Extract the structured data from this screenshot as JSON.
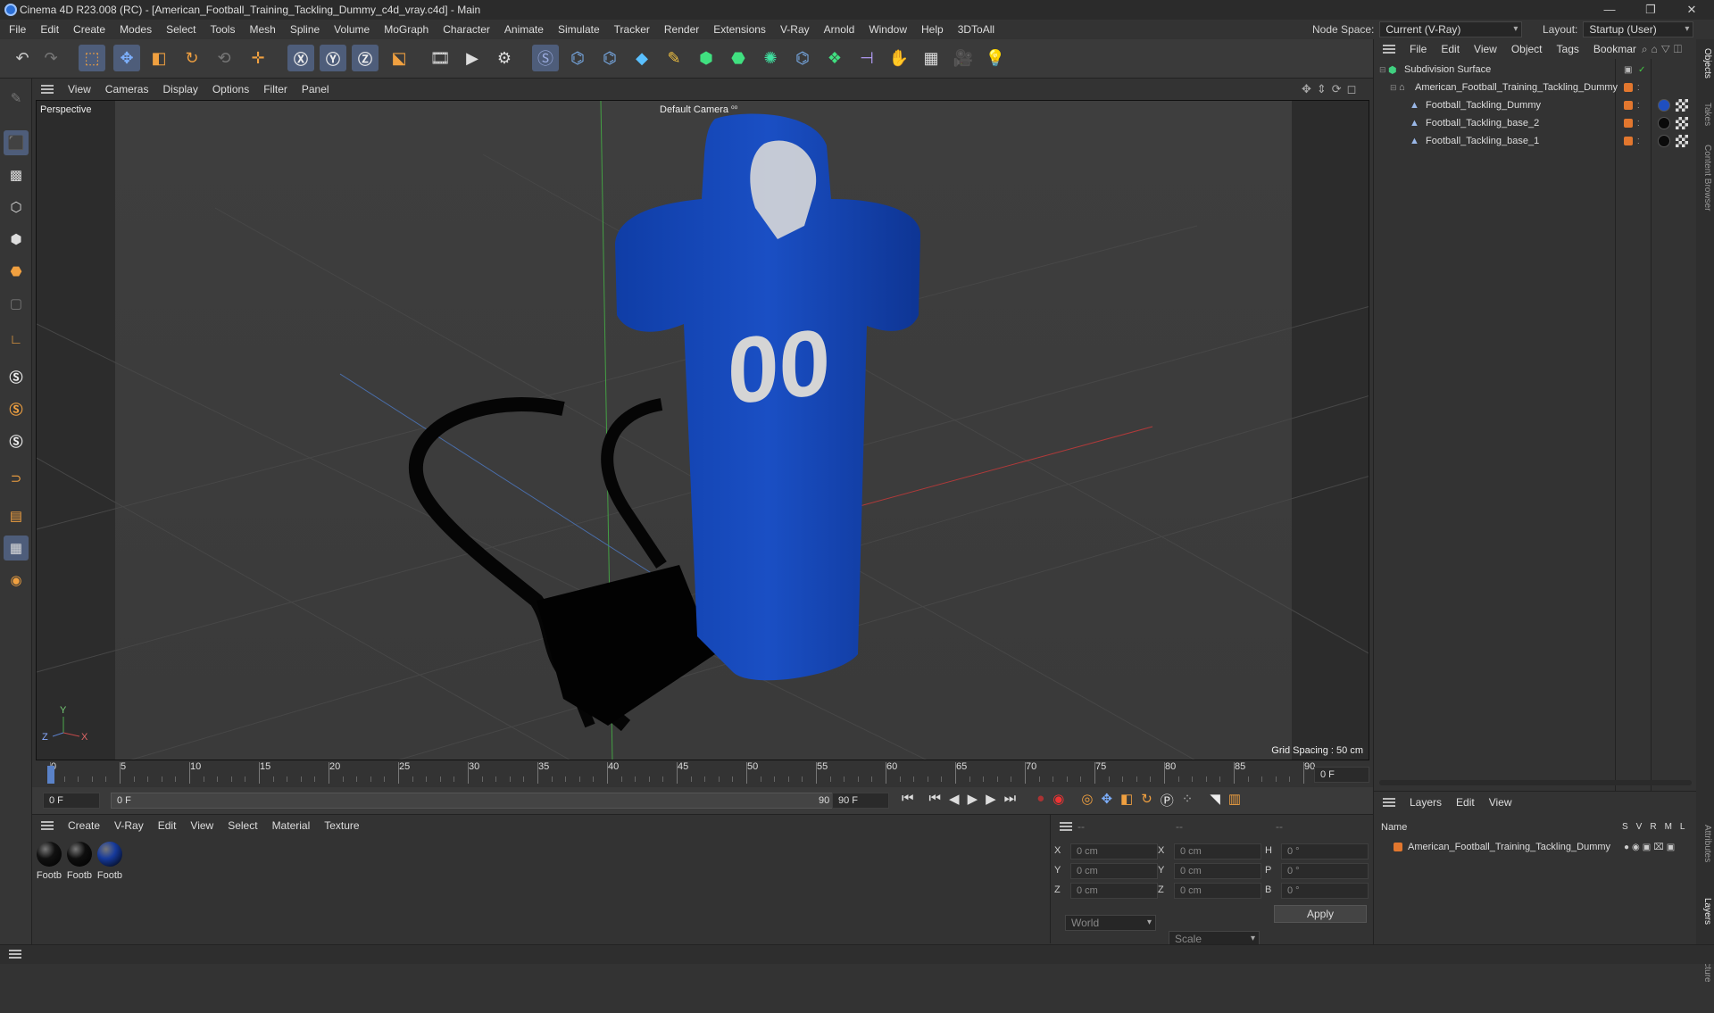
{
  "window": {
    "title": "Cinema 4D R23.008 (RC) - [American_Football_Training_Tackling_Dummy_c4d_vray.c4d] - Main",
    "minimize": "—",
    "restore": "❐",
    "close": "✕"
  },
  "menubar": {
    "items": [
      "File",
      "Edit",
      "Create",
      "Modes",
      "Select",
      "Tools",
      "Mesh",
      "Spline",
      "Volume",
      "MoGraph",
      "Character",
      "Animate",
      "Simulate",
      "Tracker",
      "Render",
      "Extensions",
      "V-Ray",
      "Arnold",
      "Window",
      "Help",
      "3DToAll"
    ],
    "node_space_label": "Node Space:",
    "node_space_value": "Current (V-Ray)",
    "layout_label": "Layout:",
    "layout_value": "Startup (User)"
  },
  "viewport": {
    "menu": [
      "View",
      "Cameras",
      "Display",
      "Options",
      "Filter",
      "Panel"
    ],
    "view_name": "Perspective",
    "camera_label": "Default Camera",
    "camera_icon": "⁰⁰",
    "grid_spacing": "Grid Spacing : 50 cm",
    "jersey_number": "00",
    "axis_y": "Y",
    "axis_z": "Z",
    "axis_x": "X"
  },
  "timeline": {
    "ticks": [
      "0",
      "5",
      "10",
      "15",
      "20",
      "25",
      "30",
      "35",
      "40",
      "45",
      "50",
      "55",
      "60",
      "65",
      "70",
      "75",
      "80",
      "85",
      "90"
    ],
    "current_frame_field": "0 F",
    "start_field": "0 F",
    "range_start": "0 F",
    "range_end": "90 F",
    "end_field": "90 F"
  },
  "material_manager": {
    "menu": [
      "Create",
      "V-Ray",
      "Edit",
      "View",
      "Select",
      "Material",
      "Texture"
    ],
    "materials": [
      {
        "label": "Footb",
        "color": "#111111"
      },
      {
        "label": "Footb",
        "color": "#0e0e0e"
      },
      {
        "label": "Footb",
        "color": "#163a9c"
      }
    ]
  },
  "coordinates": {
    "header_dashes": [
      "--",
      "--",
      "--"
    ],
    "rows": [
      {
        "a": "X",
        "av": "0 cm",
        "b": "X",
        "bv": "0 cm",
        "c": "H",
        "cv": "0 °"
      },
      {
        "a": "Y",
        "av": "0 cm",
        "b": "Y",
        "bv": "0 cm",
        "c": "P",
        "cv": "0 °"
      },
      {
        "a": "Z",
        "av": "0 cm",
        "b": "Z",
        "bv": "0 cm",
        "c": "B",
        "cv": "0 °"
      }
    ],
    "space": "World",
    "mode": "Scale",
    "apply": "Apply"
  },
  "object_manager": {
    "menu": [
      "File",
      "Edit",
      "View",
      "Object",
      "Tags",
      "Bookmar"
    ],
    "objects": [
      {
        "name": "Subdivision Surface",
        "indent": 0
      },
      {
        "name": "American_Football_Training_Tackling_Dummy",
        "indent": 1
      },
      {
        "name": "Football_Tackling_Dummy",
        "indent": 2
      },
      {
        "name": "Football_Tackling_base_2",
        "indent": 2
      },
      {
        "name": "Football_Tackling_base_1",
        "indent": 2
      }
    ]
  },
  "layer_manager": {
    "menu": [
      "Layers",
      "Edit",
      "View"
    ],
    "col_name": "Name",
    "cols": [
      "S",
      "V",
      "R",
      "M",
      "L"
    ],
    "layers": [
      {
        "name": "American_Football_Training_Tackling_Dummy",
        "color": "#e2772e"
      }
    ]
  },
  "side_tabs": [
    "Objects",
    "Takes",
    "Content Browser",
    "Attributes",
    "Layers",
    "Structure"
  ],
  "colors": {
    "accent": "#e2772e",
    "dummy_blue": "#1747b5",
    "selection": "#4e5d7a"
  }
}
